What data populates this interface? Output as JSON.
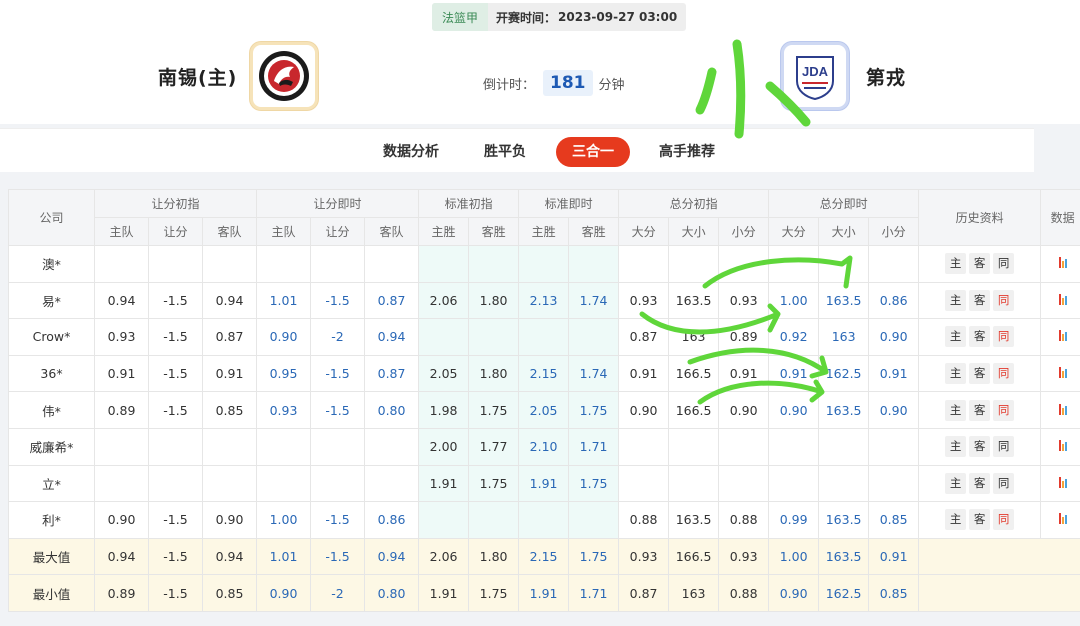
{
  "header": {
    "league": "法篮甲",
    "kickoff_label": "开赛时间：",
    "kickoff_value": "2023-09-27 03:00",
    "home_team": "南锡(主)",
    "away_team": "第戎",
    "countdown_label": "倒计时：",
    "countdown_value": "181",
    "countdown_unit": "分钟",
    "away_logo_text": "JDA"
  },
  "tabs": [
    {
      "label": "数据分析",
      "active": false
    },
    {
      "label": "胜平负",
      "active": false
    },
    {
      "label": "三合一",
      "active": true
    },
    {
      "label": "高手推荐",
      "active": false
    }
  ],
  "table": {
    "company_header": "公司",
    "groups": [
      "让分初指",
      "让分即时",
      "标准初指",
      "标准即时",
      "总分初指",
      "总分即时",
      "历史资料",
      "数据"
    ],
    "sub_headers": {
      "handicap": [
        "主队",
        "让分",
        "客队"
      ],
      "standard": [
        "主胜",
        "客胜"
      ],
      "total": [
        "大分",
        "大小",
        "小分"
      ]
    },
    "history_buttons": [
      "主",
      "客",
      "同"
    ],
    "rows": [
      {
        "company": "澳*",
        "hi": [
          "",
          "",
          ""
        ],
        "hn": [
          "",
          "",
          ""
        ],
        "si": [
          "",
          ""
        ],
        "sn": [
          "",
          ""
        ],
        "ti": [
          "",
          "",
          ""
        ],
        "tn": [
          "",
          "",
          ""
        ],
        "history": true,
        "same_red": false
      },
      {
        "company": "易*",
        "hi": [
          "0.94",
          "-1.5",
          "0.94"
        ],
        "hn": [
          "1.01",
          "-1.5",
          "0.87"
        ],
        "si": [
          "2.06",
          "1.80"
        ],
        "sn": [
          "2.13",
          "1.74"
        ],
        "ti": [
          "0.93",
          "163.5",
          "0.93"
        ],
        "tn": [
          "1.00",
          "163.5",
          "0.86"
        ],
        "history": true,
        "same_red": true
      },
      {
        "company": "Crow*",
        "hi": [
          "0.93",
          "-1.5",
          "0.87"
        ],
        "hn": [
          "0.90",
          "-2",
          "0.94"
        ],
        "si": [
          "",
          ""
        ],
        "sn": [
          "",
          ""
        ],
        "ti": [
          "0.87",
          "163",
          "0.89"
        ],
        "tn": [
          "0.92",
          "163",
          "0.90"
        ],
        "history": true,
        "same_red": true
      },
      {
        "company": "36*",
        "hi": [
          "0.91",
          "-1.5",
          "0.91"
        ],
        "hn": [
          "0.95",
          "-1.5",
          "0.87"
        ],
        "si": [
          "2.05",
          "1.80"
        ],
        "sn": [
          "2.15",
          "1.74"
        ],
        "ti": [
          "0.91",
          "166.5",
          "0.91"
        ],
        "tn": [
          "0.91",
          "162.5",
          "0.91"
        ],
        "history": true,
        "same_red": true
      },
      {
        "company": "伟*",
        "hi": [
          "0.89",
          "-1.5",
          "0.85"
        ],
        "hn": [
          "0.93",
          "-1.5",
          "0.80"
        ],
        "si": [
          "1.98",
          "1.75"
        ],
        "sn": [
          "2.05",
          "1.75"
        ],
        "ti": [
          "0.90",
          "166.5",
          "0.90"
        ],
        "tn": [
          "0.90",
          "163.5",
          "0.90"
        ],
        "history": true,
        "same_red": true
      },
      {
        "company": "威廉希*",
        "hi": [
          "",
          "",
          ""
        ],
        "hn": [
          "",
          "",
          ""
        ],
        "si": [
          "2.00",
          "1.77"
        ],
        "sn": [
          "2.10",
          "1.71"
        ],
        "ti": [
          "",
          "",
          ""
        ],
        "tn": [
          "",
          "",
          ""
        ],
        "history": true,
        "same_red": false
      },
      {
        "company": "立*",
        "hi": [
          "",
          "",
          ""
        ],
        "hn": [
          "",
          "",
          ""
        ],
        "si": [
          "1.91",
          "1.75"
        ],
        "sn": [
          "1.91",
          "1.75"
        ],
        "ti": [
          "",
          "",
          ""
        ],
        "tn": [
          "",
          "",
          ""
        ],
        "history": true,
        "same_red": false
      },
      {
        "company": "利*",
        "hi": [
          "0.90",
          "-1.5",
          "0.90"
        ],
        "hn": [
          "1.00",
          "-1.5",
          "0.86"
        ],
        "si": [
          "",
          ""
        ],
        "sn": [
          "",
          ""
        ],
        "ti": [
          "0.88",
          "163.5",
          "0.88"
        ],
        "tn": [
          "0.99",
          "163.5",
          "0.85"
        ],
        "history": true,
        "same_red": true
      }
    ],
    "stats": [
      {
        "company": "最大值",
        "hi": [
          "0.94",
          "-1.5",
          "0.94"
        ],
        "hn": [
          "1.01",
          "-1.5",
          "0.94"
        ],
        "si": [
          "2.06",
          "1.80"
        ],
        "sn": [
          "2.15",
          "1.75"
        ],
        "ti": [
          "0.93",
          "166.5",
          "0.93"
        ],
        "tn": [
          "1.00",
          "163.5",
          "0.91"
        ]
      },
      {
        "company": "最小值",
        "hi": [
          "0.89",
          "-1.5",
          "0.85"
        ],
        "hn": [
          "0.90",
          "-2",
          "0.80"
        ],
        "si": [
          "1.91",
          "1.75"
        ],
        "sn": [
          "1.91",
          "1.71"
        ],
        "ti": [
          "0.87",
          "163",
          "0.88"
        ],
        "tn": [
          "0.90",
          "162.5",
          "0.85"
        ]
      }
    ]
  },
  "colors": {
    "accent_red": "#e63a1e",
    "odds_blue": "#2a68b6",
    "annotation_green": "#5fd63a",
    "bar_icon": [
      "#e23b2e",
      "#f2a33a",
      "#4aa3df"
    ]
  },
  "annotation": {
    "handwritten": "小"
  }
}
